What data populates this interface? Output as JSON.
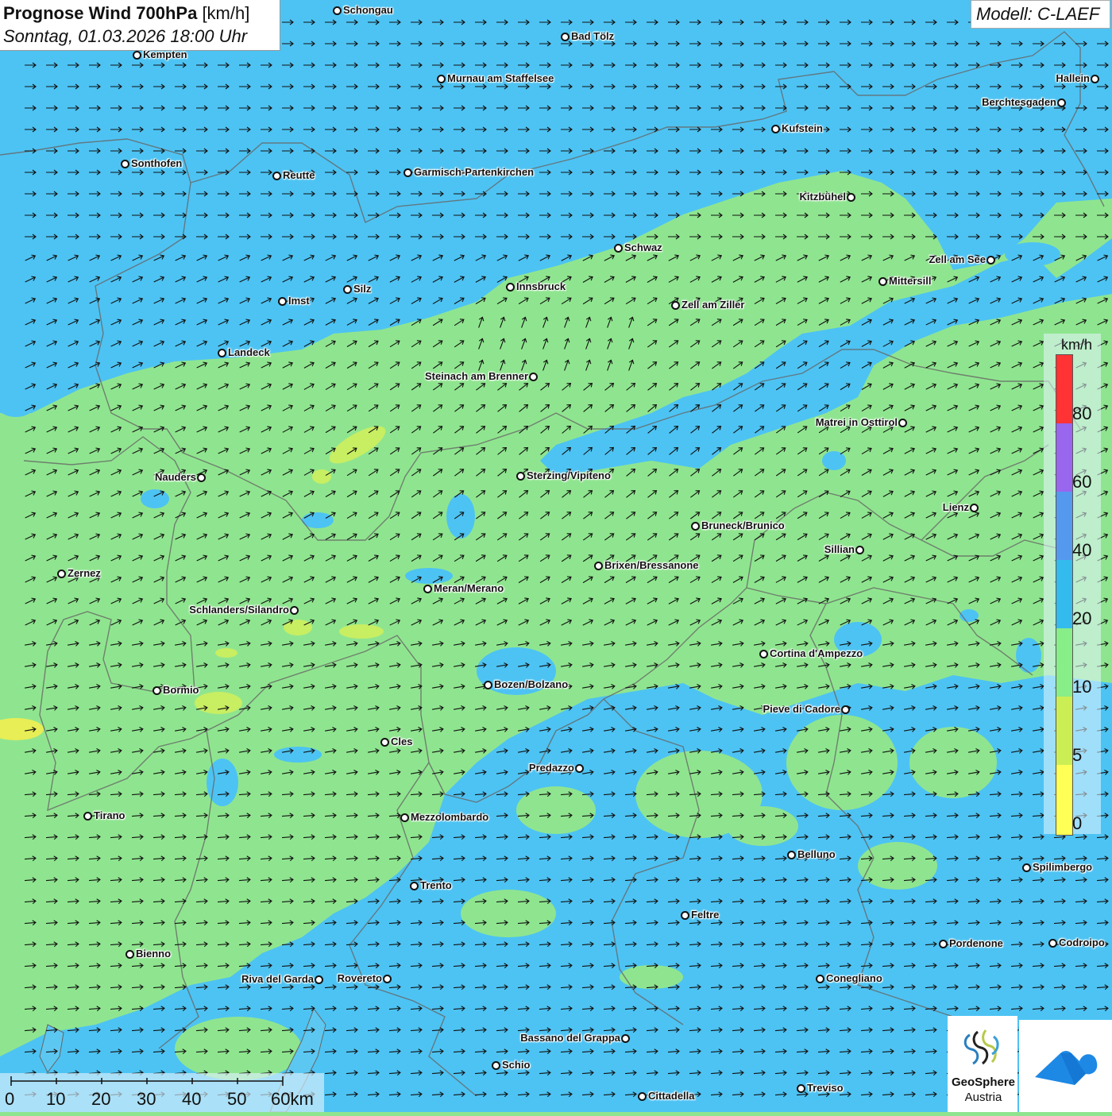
{
  "title": {
    "main": "Prognose Wind 700hPa",
    "unit": "[km/h]",
    "datetime": "Sonntag, 01.03.2026 18:00 Uhr"
  },
  "model": "Modell: C-LAEF",
  "legend": {
    "unit": "km/h",
    "labels": [
      "80",
      "60",
      "40",
      "20",
      "10",
      "5",
      "0"
    ],
    "colors": [
      "#ff3333",
      "#9966ee",
      "#5599ee",
      "#33bbee",
      "#88ee88",
      "#ccee55",
      "#ffff55"
    ]
  },
  "scalebar": {
    "labels": [
      "0",
      "10",
      "20",
      "30",
      "40",
      "50",
      "60km"
    ]
  },
  "logos": {
    "geosphere_line1": "GeoSphere",
    "geosphere_line2": "Austria"
  },
  "cities": [
    {
      "name": "Schongau"
    },
    {
      "name": "Bad Tölz"
    },
    {
      "name": "Kempten"
    },
    {
      "name": "Murnau am Staffelsee"
    },
    {
      "name": "Hallein"
    },
    {
      "name": "Berchtesgaden"
    },
    {
      "name": "Kufstein"
    },
    {
      "name": "Sonthofen"
    },
    {
      "name": "Reutte"
    },
    {
      "name": "Garmisch-Partenkirchen"
    },
    {
      "name": "Kitzbühel"
    },
    {
      "name": "Schwaz"
    },
    {
      "name": "Zell am See"
    },
    {
      "name": "Mittersill"
    },
    {
      "name": "Innsbruck"
    },
    {
      "name": "Silz"
    },
    {
      "name": "Imst"
    },
    {
      "name": "Zell am Ziller"
    },
    {
      "name": "Landeck"
    },
    {
      "name": "Steinach am Brenner"
    },
    {
      "name": "Matrei in Osttirol"
    },
    {
      "name": "Nauders"
    },
    {
      "name": "Sterzing/Vipiteno"
    },
    {
      "name": "Lienz"
    },
    {
      "name": "Bruneck/Brunico"
    },
    {
      "name": "Sillian"
    },
    {
      "name": "Brixen/Bressanone"
    },
    {
      "name": "Zernez"
    },
    {
      "name": "Meran/Merano"
    },
    {
      "name": "Schlanders/Silandro"
    },
    {
      "name": "Cortina d'Ampezzo"
    },
    {
      "name": "Bozen/Bolzano"
    },
    {
      "name": "Bormio"
    },
    {
      "name": "Pieve di Cadore"
    },
    {
      "name": "Cles"
    },
    {
      "name": "Predazzo"
    },
    {
      "name": "Tirano"
    },
    {
      "name": "Mezzolombardo"
    },
    {
      "name": "Belluno"
    },
    {
      "name": "Spilimbergo"
    },
    {
      "name": "Trento"
    },
    {
      "name": "Feltre"
    },
    {
      "name": "Pordenone"
    },
    {
      "name": "Codroipo"
    },
    {
      "name": "Bienno"
    },
    {
      "name": "Riva del Garda"
    },
    {
      "name": "Rovereto"
    },
    {
      "name": "Conegliano"
    },
    {
      "name": "Bassano del Grappa"
    },
    {
      "name": "Schio"
    },
    {
      "name": "Treviso"
    },
    {
      "name": "Cittadella"
    }
  ]
}
